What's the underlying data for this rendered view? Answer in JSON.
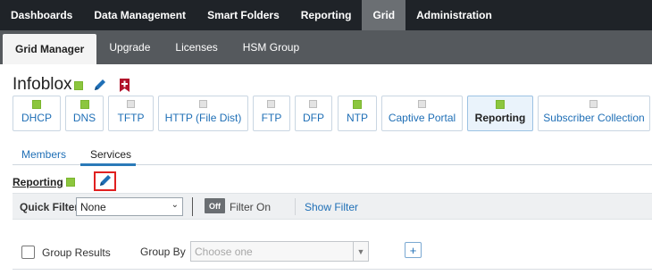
{
  "topnav": {
    "tabs": [
      {
        "label": "Dashboards"
      },
      {
        "label": "Data Management"
      },
      {
        "label": "Smart Folders"
      },
      {
        "label": "Reporting"
      },
      {
        "label": "Grid",
        "active": true
      },
      {
        "label": "Administration"
      }
    ]
  },
  "subnav": {
    "tabs": [
      {
        "label": "Grid Manager",
        "active": true
      },
      {
        "label": "Upgrade"
      },
      {
        "label": "Licenses"
      },
      {
        "label": "HSM Group"
      }
    ]
  },
  "grid": {
    "title": "Infoblox",
    "status_color": "#8cc63e",
    "edit_icon": "pencil-icon",
    "bookmark_icon": "bookmark-plus-icon"
  },
  "services": [
    {
      "label": "DHCP",
      "status": "running"
    },
    {
      "label": "DNS",
      "status": "running"
    },
    {
      "label": "TFTP",
      "status": "inactive"
    },
    {
      "label": "HTTP (File Dist)",
      "status": "inactive"
    },
    {
      "label": "FTP",
      "status": "inactive"
    },
    {
      "label": "DFP",
      "status": "inactive"
    },
    {
      "label": "NTP",
      "status": "running"
    },
    {
      "label": "Captive Portal",
      "status": "inactive"
    },
    {
      "label": "Reporting",
      "status": "running",
      "active": true
    },
    {
      "label": "Subscriber Collection",
      "status": "inactive"
    }
  ],
  "detail_tabs": [
    {
      "label": "Members"
    },
    {
      "label": "Services",
      "active": true
    }
  ],
  "section": {
    "title": "Reporting",
    "status": "running"
  },
  "filter": {
    "quick_filter_label": "Quick Filter",
    "quick_filter_value": "None",
    "toggle_label": "Off",
    "filter_on_label": "Filter On",
    "show_filter_label": "Show Filter"
  },
  "grouping": {
    "group_results_label": "Group Results",
    "group_by_label": "Group By",
    "group_by_placeholder": "Choose one",
    "add_label": "+"
  },
  "colors": {
    "running": "#8cc63e",
    "inactive": "#e3e3e3",
    "link": "#1f6fb6",
    "topnav_bg": "#1f2328"
  }
}
